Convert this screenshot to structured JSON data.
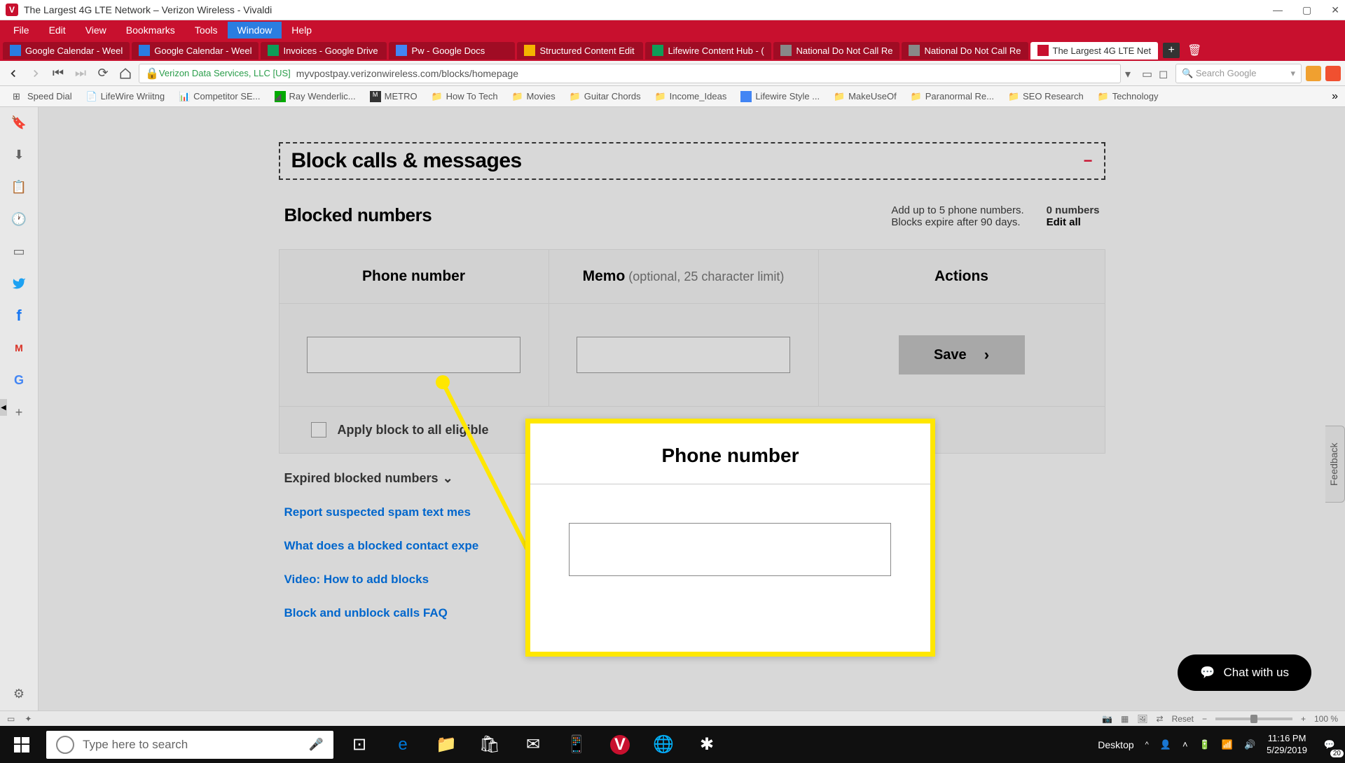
{
  "window": {
    "title": "The Largest 4G LTE Network – Verizon Wireless - Vivaldi",
    "app_glyph": "V"
  },
  "menubar": [
    "File",
    "Edit",
    "View",
    "Bookmarks",
    "Tools",
    "Window",
    "Help"
  ],
  "menubar_active_index": 5,
  "tabs": [
    {
      "label": "Google Calendar - Weel",
      "active": false
    },
    {
      "label": "Google Calendar - Weel",
      "active": false
    },
    {
      "label": "Invoices - Google Drive",
      "active": false
    },
    {
      "label": "Pw - Google Docs",
      "active": false
    },
    {
      "label": "Structured Content Edit",
      "active": false
    },
    {
      "label": "Lifewire Content Hub - (",
      "active": false
    },
    {
      "label": "National Do Not Call Re",
      "active": false
    },
    {
      "label": "National Do Not Call Re",
      "active": false
    },
    {
      "label": "The Largest 4G LTE Net",
      "active": true
    }
  ],
  "addressbar": {
    "org": "Verizon Data Services, LLC [US]",
    "url": "myvpostpay.verizonwireless.com/blocks/homepage",
    "search_placeholder": "Search Google"
  },
  "bookmarks": [
    "Speed Dial",
    "LifeWire Wriitng",
    "Competitor SE...",
    "Ray Wenderlic...",
    "METRO",
    "How To Tech",
    "Movies",
    "Guitar Chords",
    "Income_Ideas",
    "Lifewire Style ...",
    "MakeUseOf",
    "Paranormal Re...",
    "SEO Research",
    "Technology"
  ],
  "page": {
    "section_title": "Block calls & messages",
    "subsection_title": "Blocked numbers",
    "info_line1": "Add up to 5 phone numbers.",
    "info_line2": "Blocks expire after 90 days.",
    "count_label": "0 numbers",
    "edit_all": "Edit all",
    "columns": {
      "phone": "Phone number",
      "memo": "Memo",
      "memo_opt": " (optional, 25 character limit)",
      "actions": "Actions"
    },
    "save_label": "Save",
    "apply_label": "Apply block to all eligible",
    "expired_label": "Expired blocked numbers",
    "links": [
      "Report suspected spam text mes",
      "What does a blocked contact expe",
      "Video: How to add blocks",
      "Block and unblock calls FAQ"
    ],
    "callout_title": "Phone number",
    "feedback": "Feedback",
    "chat": "Chat with us"
  },
  "statusbar": {
    "reset": "Reset",
    "zoom": "100 %"
  },
  "taskbar": {
    "search_placeholder": "Type here to search",
    "desktop": "Desktop",
    "time": "11:16 PM",
    "date": "5/29/2019",
    "notif_count": "20"
  }
}
